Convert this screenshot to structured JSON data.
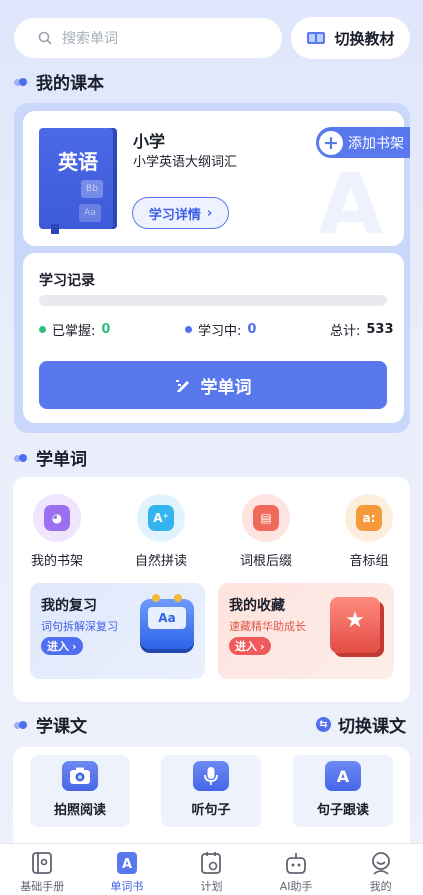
{
  "search": {
    "placeholder": "搜索单词",
    "icon": "search-icon"
  },
  "switch_book": {
    "label": "切换教材",
    "icon": "book-icon"
  },
  "my_textbook": {
    "title": "我的课本",
    "book": {
      "cover_text": "英语",
      "cover_deco_1": "Bb",
      "cover_deco_2": "Aa",
      "level": "小学",
      "name": "小学英语大纲词汇",
      "detail_button": "学习详情",
      "watermark": "A"
    },
    "add_shelf": "添加书架",
    "record": {
      "title": "学习记录",
      "progress_fraction": 0,
      "mastered_label": "已掌握:",
      "mastered_value": "0",
      "learning_label": "学习中:",
      "learning_value": "0",
      "total_label": "总计:",
      "total_value": "533",
      "learn_button": "学单词"
    }
  },
  "learn_words": {
    "title": "学单词",
    "tools": [
      {
        "label": "我的书架",
        "icon": "bookshelf-icon",
        "color": "#9b6ff0"
      },
      {
        "label": "自然拼读",
        "icon": "phonics-icon",
        "color": "#35b4f0"
      },
      {
        "label": "词根后缀",
        "icon": "root-book-icon",
        "color": "#f06a5c"
      },
      {
        "label": "音标组",
        "icon": "phonetic-icon",
        "color": "#f59a3a"
      }
    ],
    "review": {
      "title": "我的复习",
      "subtitle": "词句拆解深复习",
      "enter": "进入",
      "badge_text": "Aa"
    },
    "collection": {
      "title": "我的收藏",
      "subtitle": "速藏精华助成长",
      "enter": "进入"
    }
  },
  "learn_text": {
    "title": "学课文",
    "switch_label": "切换课文",
    "tiles": [
      {
        "label": "拍照阅读",
        "icon": "camera-icon"
      },
      {
        "label": "听句子",
        "icon": "microphone-icon"
      },
      {
        "label": "句子跟读",
        "icon": "read-along-icon"
      }
    ]
  },
  "tabbar": [
    {
      "label": "基础手册",
      "icon": "handbook-icon",
      "active": false
    },
    {
      "label": "单词书",
      "icon": "wordbook-icon",
      "active": true
    },
    {
      "label": "计划",
      "icon": "plan-icon",
      "active": false
    },
    {
      "label": "AI助手",
      "icon": "robot-icon",
      "active": false
    },
    {
      "label": "我的",
      "icon": "profile-icon",
      "active": false
    }
  ],
  "colors": {
    "primary": "#5a78ee",
    "mastered": "#2fc07d",
    "learning": "#4f6ef0",
    "collect": "#f05a5a"
  }
}
